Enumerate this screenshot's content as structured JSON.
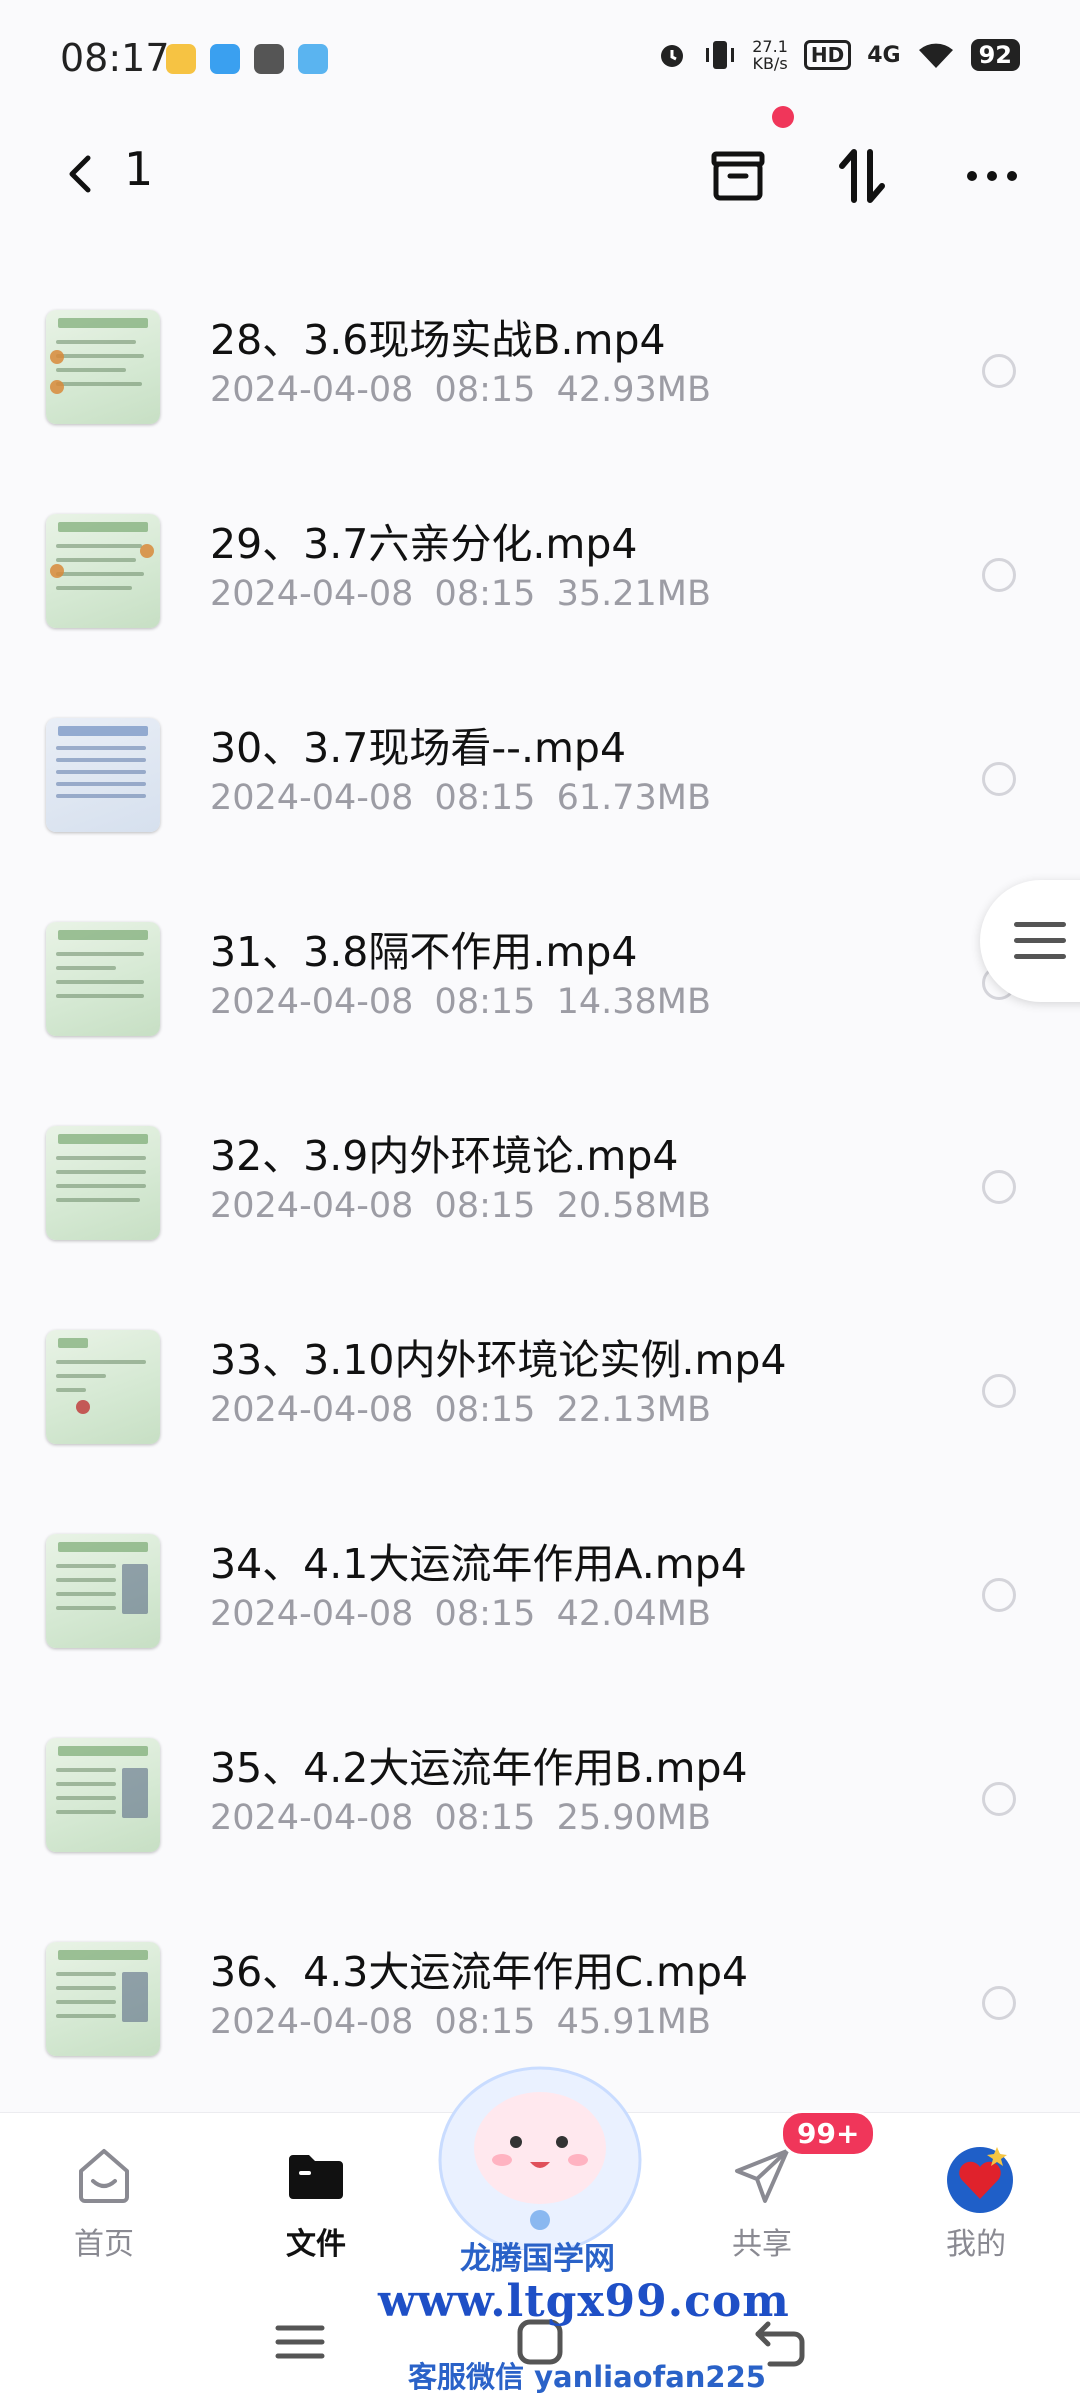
{
  "status_bar": {
    "time": "08:17",
    "net_speed_value": "27.1",
    "net_speed_unit": "KB/s",
    "hd": "HD",
    "network": "4G",
    "battery": "92"
  },
  "header": {
    "title": "1"
  },
  "files": [
    {
      "name": "28、3.6现场实战B.mp4",
      "date": "2024-04-08",
      "time": "08:15",
      "size": "42.93MB"
    },
    {
      "name": "29、3.7六亲分化.mp4",
      "date": "2024-04-08",
      "time": "08:15",
      "size": "35.21MB"
    },
    {
      "name": "30、3.7现场看--.mp4",
      "date": "2024-04-08",
      "time": "08:15",
      "size": "61.73MB"
    },
    {
      "name": "31、3.8隔不作用.mp4",
      "date": "2024-04-08",
      "time": "08:15",
      "size": "14.38MB"
    },
    {
      "name": "32、3.9内外环境论.mp4",
      "date": "2024-04-08",
      "time": "08:15",
      "size": "20.58MB"
    },
    {
      "name": "33、3.10内外环境论实例.mp4",
      "date": "2024-04-08",
      "time": "08:15",
      "size": "22.13MB"
    },
    {
      "name": "34、4.1大运流年作用A.mp4",
      "date": "2024-04-08",
      "time": "08:15",
      "size": "42.04MB"
    },
    {
      "name": "35、4.2大运流年作用B.mp4",
      "date": "2024-04-08",
      "time": "08:15",
      "size": "25.90MB"
    },
    {
      "name": "36、4.3大运流年作用C.mp4",
      "date": "2024-04-08",
      "time": "08:15",
      "size": "45.91MB"
    }
  ],
  "tabs": {
    "home": "首页",
    "files": "文件",
    "share": "共享",
    "mine": "我的",
    "share_badge": "99+"
  },
  "watermark": {
    "line1": "龙腾国学网",
    "line2": "www.ltgx99.com",
    "line3": "客服微信 yanliaofan225"
  },
  "colors": {
    "accent": "#f0365a",
    "watermark": "#1e4fc6",
    "meta_text": "#9c9ca4"
  }
}
